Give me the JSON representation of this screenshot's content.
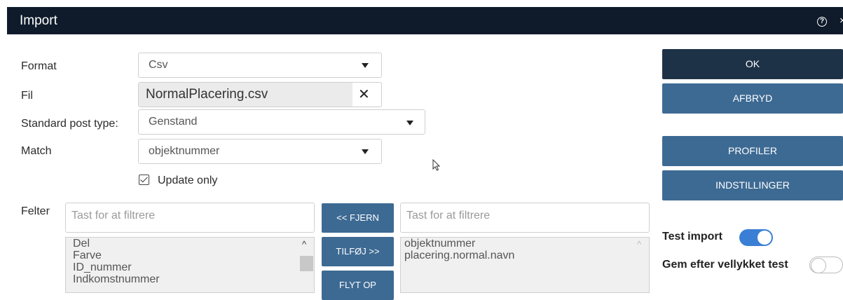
{
  "dialog": {
    "title": "Import"
  },
  "form": {
    "format": {
      "label": "Format",
      "value": "Csv"
    },
    "file": {
      "label": "Fil",
      "value": "NormalPlacering.csv"
    },
    "default_post_type": {
      "label": "Standard post type:",
      "value": "Genstand"
    },
    "match": {
      "label": "Match",
      "value": "objektnummer"
    },
    "update_only": {
      "label": "Update only",
      "checked": true
    },
    "fields_label": "Felter"
  },
  "available_fields": {
    "filter_placeholder": "Tast for at filtrere",
    "items": [
      "Del",
      "Farve",
      "ID_nummer",
      "Indkomstnummer"
    ]
  },
  "selected_fields": {
    "filter_placeholder": "Tast for at filtrere",
    "items": [
      "objektnummer",
      "placering.normal.navn"
    ]
  },
  "middle_buttons": {
    "remove": "<< FJERN",
    "add": "TILFØJ >>",
    "move_up": "FLYT OP"
  },
  "side_buttons": {
    "ok": "OK",
    "cancel": "AFBRYD",
    "profiles": "PROFILER",
    "settings": "INDSTILLINGER"
  },
  "toggles": {
    "test_import": {
      "label": "Test import",
      "on": true
    },
    "save_after_test": {
      "label": "Gem efter vellykket test",
      "on": false
    }
  },
  "colors": {
    "titlebar": "#0f1b2b",
    "button_primary": "#3d6a93",
    "button_ok": "#1e3247",
    "toggle_on": "#3a7fd5"
  }
}
